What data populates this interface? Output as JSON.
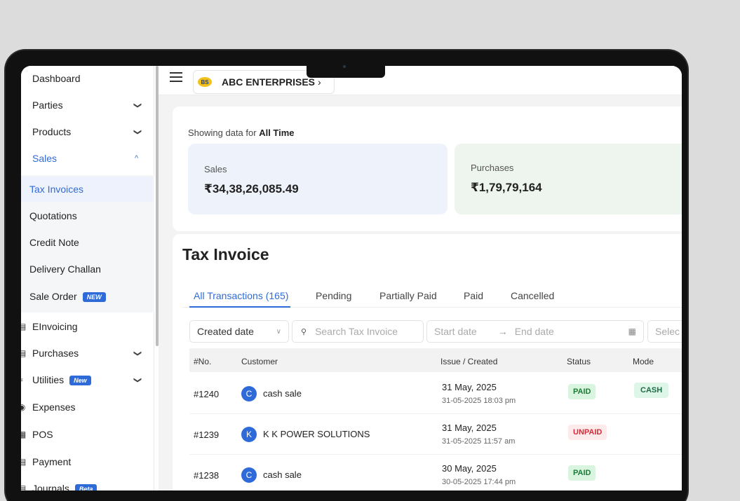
{
  "sidebar": {
    "items": [
      {
        "label": "Dashboard"
      },
      {
        "label": "Parties"
      },
      {
        "label": "Products"
      },
      {
        "label": "Sales"
      },
      {
        "label": "Tax Invoices"
      },
      {
        "label": "Quotations"
      },
      {
        "label": "Credit Note"
      },
      {
        "label": "Delivery Challan"
      },
      {
        "label": "Sale Order",
        "badge": "NEW"
      },
      {
        "label": "EInvoicing"
      },
      {
        "label": "Purchases"
      },
      {
        "label": "Utilities",
        "badge": "New"
      },
      {
        "label": "Expenses"
      },
      {
        "label": "POS"
      },
      {
        "label": "Payment"
      },
      {
        "label": "Journals",
        "badge": "Beta"
      }
    ]
  },
  "topbar": {
    "company_name": "ABC ENTERPRISES",
    "logo_text": "BS"
  },
  "summary": {
    "showing_prefix": "Showing data for",
    "showing_period": "All Time",
    "sales_label": "Sales",
    "sales_value": "₹34,38,26,085.49",
    "purchases_label": "Purchases",
    "purchases_value": "₹1,79,79,164"
  },
  "invoice": {
    "title": "Tax Invoice",
    "tabs": [
      {
        "label": "All Transactions (165)"
      },
      {
        "label": "Pending"
      },
      {
        "label": "Partially Paid"
      },
      {
        "label": "Paid"
      },
      {
        "label": "Cancelled"
      }
    ],
    "filters": {
      "sort_value": "Created date",
      "search_placeholder": "Search Tax Invoice",
      "start_placeholder": "Start date",
      "end_placeholder": "End date",
      "select_placeholder": "Selec"
    },
    "columns": [
      "#No.",
      "Customer",
      "Issue / Created",
      "Status",
      "Mode"
    ],
    "rows": [
      {
        "no": "#1240",
        "initial": "C",
        "customer": "cash sale",
        "issue": "31 May, 2025",
        "created": "31-05-2025 18:03 pm",
        "status": "PAID",
        "mode": "CASH"
      },
      {
        "no": "#1239",
        "initial": "K",
        "customer": "K K POWER SOLUTIONS",
        "issue": "31 May, 2025",
        "created": "31-05-2025 11:57 am",
        "status": "UNPAID",
        "mode": ""
      },
      {
        "no": "#1238",
        "initial": "C",
        "customer": "cash sale",
        "issue": "30 May, 2025",
        "created": "30-05-2025 17:44 pm",
        "status": "PAID",
        "mode": ""
      }
    ]
  },
  "colors": {
    "accent": "#2f6bd8",
    "paid_bg": "#d9f5df",
    "unpaid_text": "#cf2d3a"
  }
}
